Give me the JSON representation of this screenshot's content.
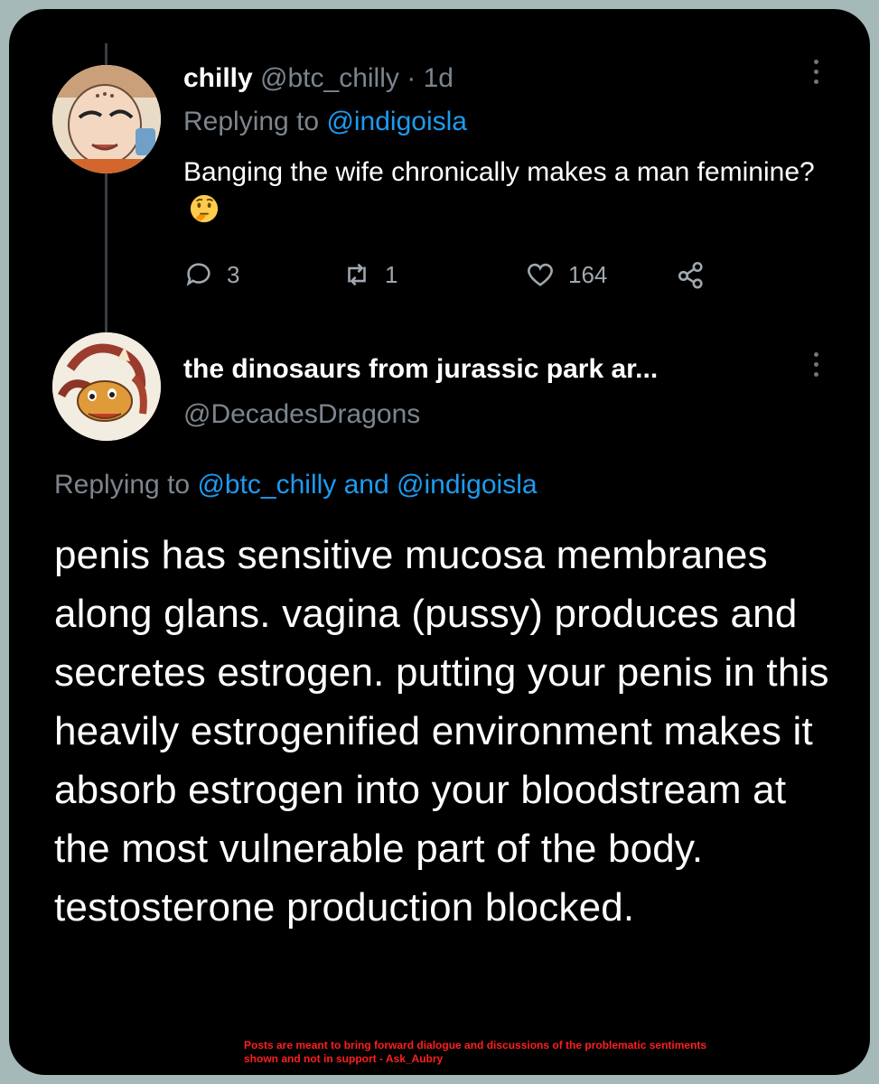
{
  "tweet1": {
    "name": "chilly",
    "handle": "@btc_chilly",
    "separator": "·",
    "time": "1d",
    "replying_prefix": "Replying to",
    "replying_to": "@indigoisla",
    "text": "Banging the wife chronically makes a man feminine?",
    "emoji": "thinking-face",
    "replies": "3",
    "retweets": "1",
    "likes": "164"
  },
  "tweet2": {
    "name": "the dinosaurs from jurassic park ar...",
    "handle": "@DecadesDragons",
    "replying_prefix": "Replying to",
    "replying_to_1": "@btc_chilly",
    "replying_and": "and",
    "replying_to_2": "@indigoisla",
    "text": "penis has sensitive mucosa membranes along glans. vagina (pussy) produces and secretes estrogen. putting your penis in this heavily estrogenified environment makes it absorb estrogen into your bloodstream at the most vulnerable part of the body. testosterone production blocked."
  },
  "disclaimer": "Posts are meant to bring forward dialogue and discussions of the problematic sentiments shown and not in support - Ask_Aubry",
  "colors": {
    "link": "#1d9bf0",
    "muted": "#7c858d",
    "background": "#000000",
    "frame": "#a4b9b8",
    "disclaimer": "#ff1f1f"
  }
}
